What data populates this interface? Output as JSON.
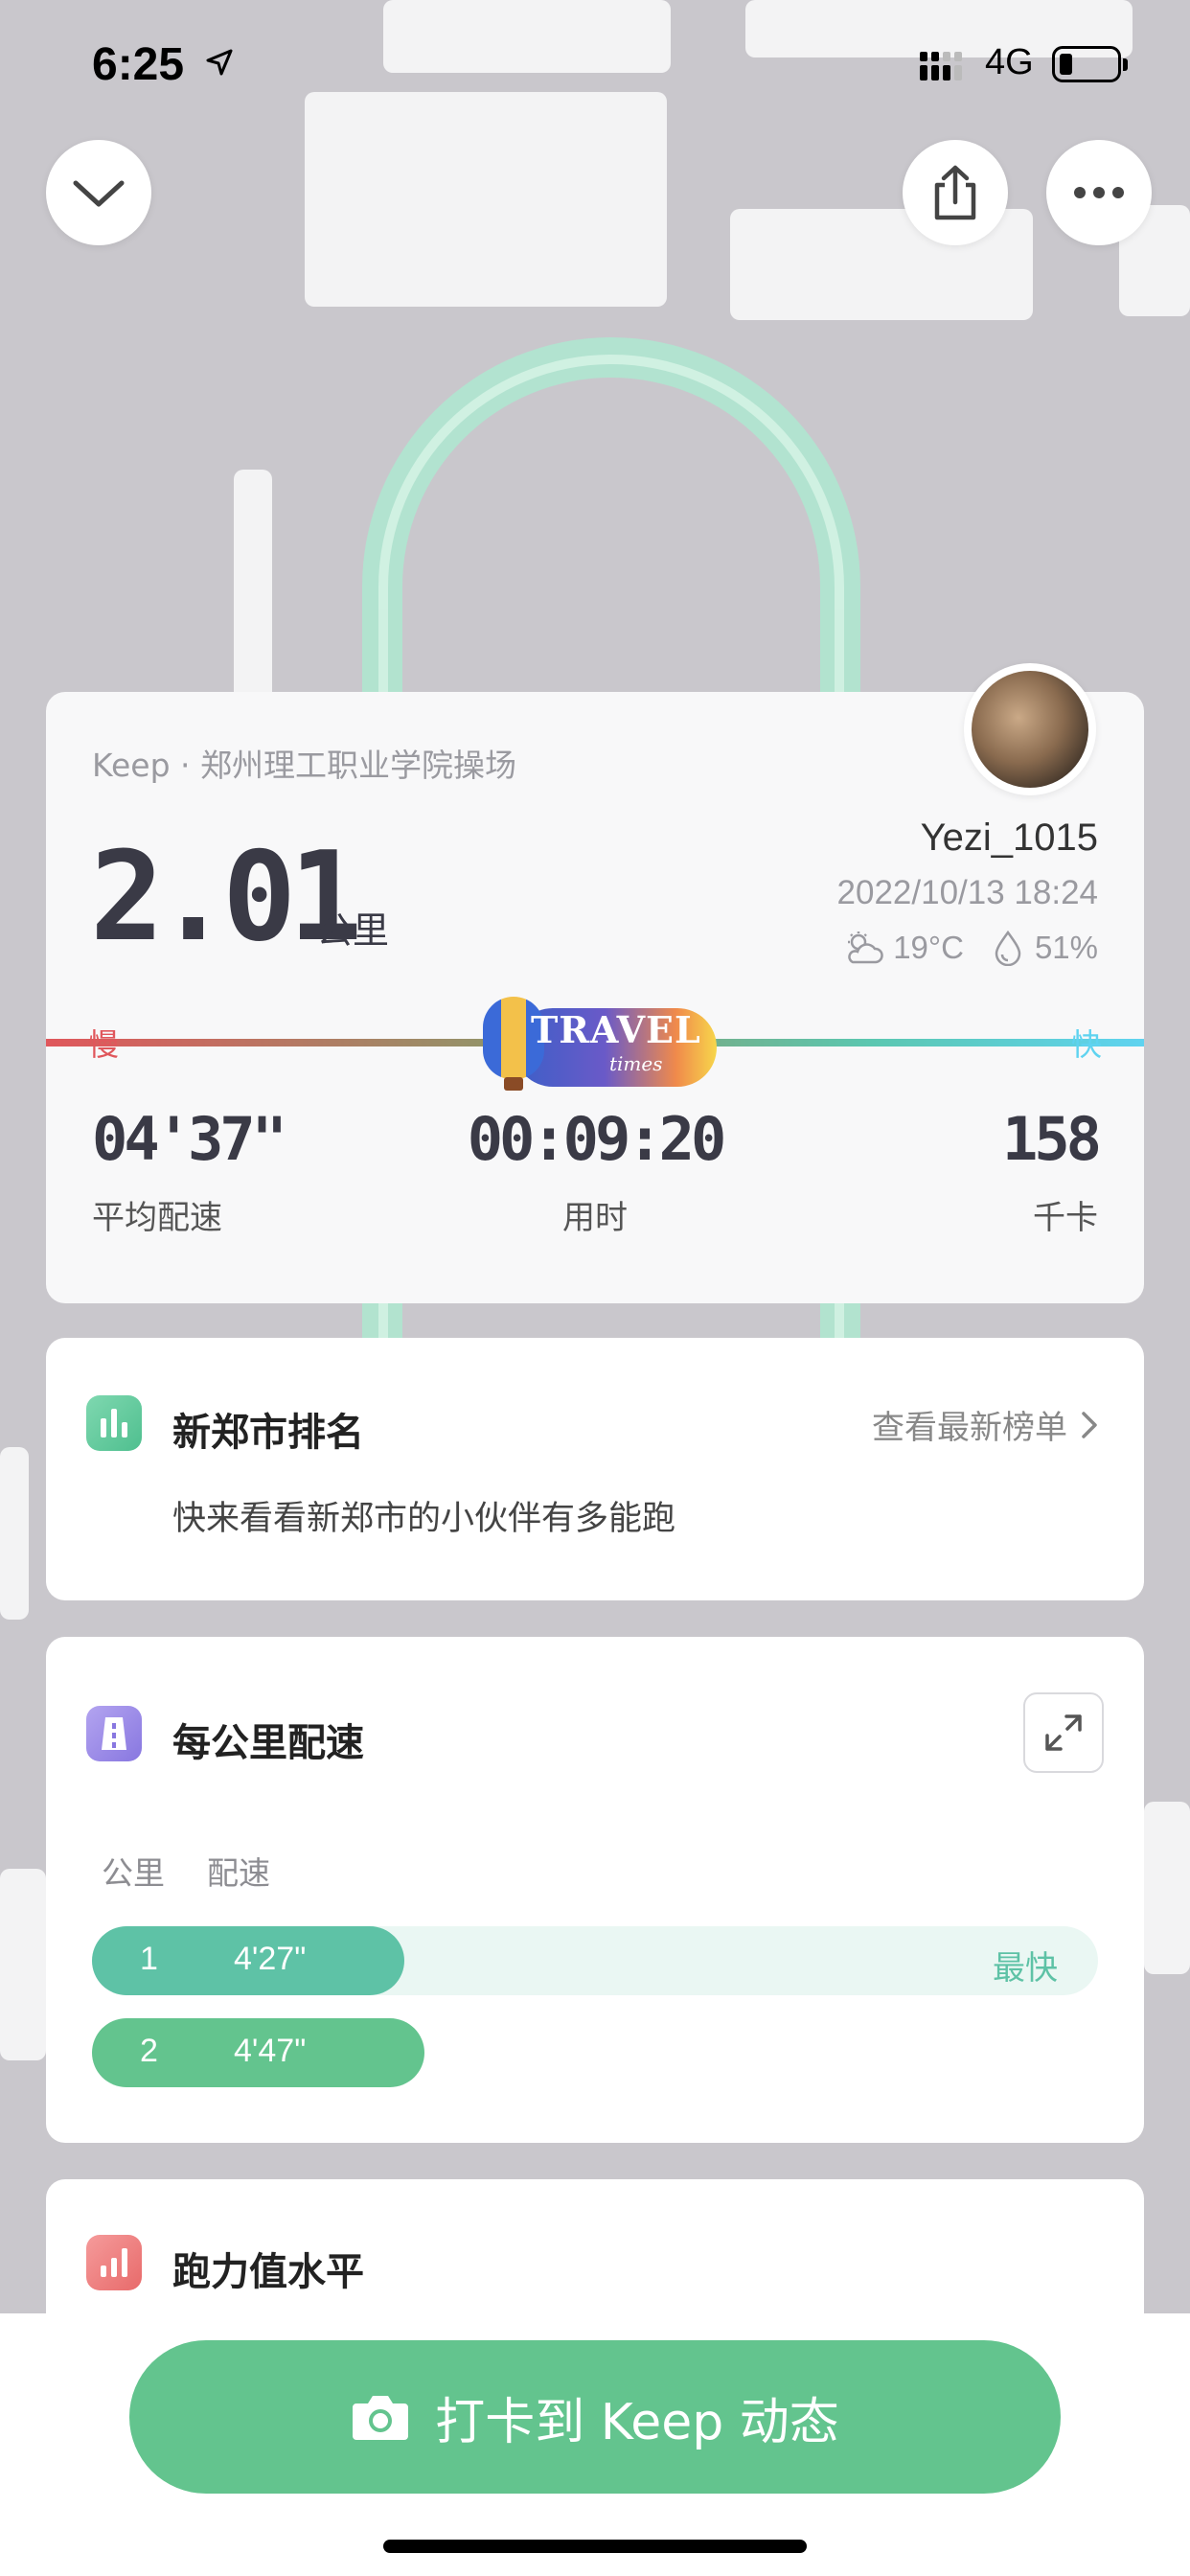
{
  "status_bar": {
    "time": "6:25",
    "network": "4G"
  },
  "summary": {
    "source": "Keep · 郑州理工职业学院操场",
    "distance": "2.01",
    "distance_unit": "公里",
    "username": "Yezi_1015",
    "datetime": "2022/10/13 18:24",
    "temperature": "19°C",
    "humidity": "51%",
    "slow_label": "慢",
    "fast_label": "快",
    "badge_title": "TRAVEL",
    "badge_subtitle": "times",
    "stats": [
      {
        "value": "04'37\"",
        "label": "平均配速"
      },
      {
        "value": "00:09:20",
        "label": "用时"
      },
      {
        "value": "158",
        "label": "千卡"
      }
    ]
  },
  "ranking": {
    "title": "新郑市排名",
    "more_label": "查看最新榜单",
    "description": "快来看看新郑市的小伙伴有多能跑"
  },
  "pace": {
    "title": "每公里配速",
    "col_km": "公里",
    "col_pace": "配速",
    "rows": [
      {
        "km": "1",
        "pace": "4'27\"",
        "fraction": 0.31,
        "tag": "最快"
      },
      {
        "km": "2",
        "pace": "4'47\"",
        "fraction": 0.33,
        "tag": ""
      }
    ]
  },
  "power": {
    "title": "跑力值水平"
  },
  "cta": {
    "label": "打卡到 Keep 动态"
  },
  "colors": {
    "accent_green": "#63c48e",
    "slow_red": "#e0575c",
    "fast_cyan": "#5fd3f0"
  }
}
